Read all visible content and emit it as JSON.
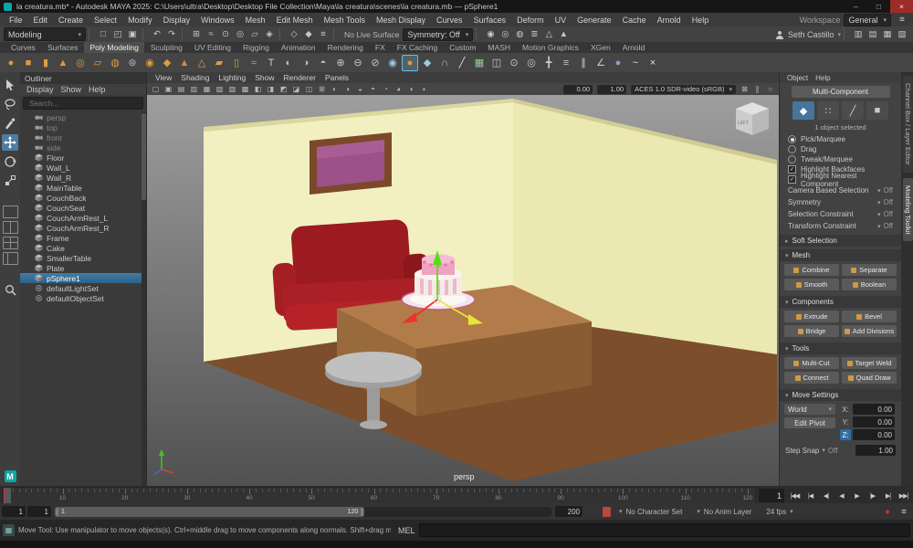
{
  "colors": {
    "accent": "#47749b",
    "selection": "#3f7ea8",
    "close_button": "#9d2c26",
    "maya_teal": "#0ba7a7",
    "manipulator_x": "#f03228",
    "manipulator_y": "#53e012",
    "manipulator_z": "#e8e43a"
  },
  "window": {
    "title": "la creatura.mb* - Autodesk MAYA 2025: C:\\Users\\ultra\\Desktop\\Desktop File Collection\\Maya\\la creatura\\scenes\\la creatura.mb — pSphere1",
    "controls": [
      {
        "name": "minimize-button",
        "glyph": "–"
      },
      {
        "name": "maximize-button",
        "glyph": "□"
      },
      {
        "name": "close-button",
        "glyph": "×",
        "close": true
      }
    ]
  },
  "menubar": {
    "items": [
      "File",
      "Edit",
      "Create",
      "Select",
      "Modify",
      "Display",
      "Windows",
      "Mesh",
      "Edit Mesh",
      "Mesh Tools",
      "Mesh Display",
      "Curves",
      "Surfaces",
      "Deform",
      "UV",
      "Generate",
      "Cache",
      "Arnold",
      "Help"
    ],
    "workspace_label": "Workspace",
    "workspace_value": "General"
  },
  "statusline": {
    "mode": "Modeling",
    "groups": [
      [
        {
          "name": "new-scene-icon",
          "glyph": "□"
        },
        {
          "name": "open-scene-icon",
          "glyph": "◰"
        },
        {
          "name": "save-scene-icon",
          "glyph": "▣"
        }
      ],
      [
        {
          "name": "undo-icon",
          "glyph": "↶"
        },
        {
          "name": "redo-icon",
          "glyph": "↷"
        }
      ],
      [
        {
          "name": "snap-to-grid-icon",
          "glyph": "⊞"
        },
        {
          "name": "snap-to-curve-icon",
          "glyph": "≈"
        },
        {
          "name": "snap-to-point-icon",
          "glyph": "⊙"
        },
        {
          "name": "snap-to-projected-center-icon",
          "glyph": "◎"
        },
        {
          "name": "snap-to-view-plane-icon",
          "glyph": "▱"
        },
        {
          "name": "make-live-icon",
          "glyph": "◈"
        }
      ],
      [
        {
          "name": "input-connections-icon",
          "glyph": "◇"
        },
        {
          "name": "output-connections-icon",
          "glyph": "◆"
        },
        {
          "name": "construction-history-icon",
          "glyph": "≡"
        }
      ]
    ],
    "live_surface": "No Live Surface",
    "symmetry": "Symmetry: Off",
    "render_group": [
      {
        "name": "open-render-view-icon",
        "glyph": "◉"
      },
      {
        "name": "render-current-frame-icon",
        "glyph": "◎"
      },
      {
        "name": "ipr-render-icon",
        "glyph": "◍"
      },
      {
        "name": "render-settings-icon",
        "glyph": "≣"
      },
      {
        "name": "toggle-displacement-icon",
        "glyph": "△"
      },
      {
        "name": "launch-arnold-icon",
        "glyph": "▲"
      }
    ],
    "user": "Seth Castillo",
    "right_icons": [
      {
        "name": "toggle-modeling-toolkit-icon",
        "glyph": "▥"
      },
      {
        "name": "toggle-attribute-editor-icon",
        "glyph": "▤"
      },
      {
        "name": "toggle-tool-settings-icon",
        "glyph": "▦"
      },
      {
        "name": "toggle-channel-box-icon",
        "glyph": "▧"
      }
    ]
  },
  "shelf": {
    "tabs": [
      "Curves",
      "Surfaces",
      "Poly Modeling",
      "Sculpting",
      "UV Editing",
      "Rigging",
      "Animation",
      "Rendering",
      "FX",
      "FX Caching",
      "Custom",
      "MASH",
      "Motion Graphics",
      "XGen",
      "Arnold"
    ],
    "active_tab": "Poly Modeling",
    "icons": [
      {
        "name": "poly-sphere-icon",
        "glyph": "●",
        "color": "#df9b41"
      },
      {
        "name": "poly-cube-icon",
        "glyph": "■",
        "color": "#df9b41"
      },
      {
        "name": "poly-cylinder-icon",
        "glyph": "▮",
        "color": "#df9b41"
      },
      {
        "name": "poly-cone-icon",
        "glyph": "▲",
        "color": "#df9b41"
      },
      {
        "name": "poly-torus-icon",
        "glyph": "◎",
        "color": "#df9b41"
      },
      {
        "name": "poly-plane-icon",
        "glyph": "▱",
        "color": "#df9b41"
      },
      {
        "name": "poly-disc-icon",
        "glyph": "◍",
        "color": "#df9b41"
      },
      {
        "name": "poly-gear-icon",
        "glyph": "⊛",
        "color": "#9fb6cc"
      },
      {
        "name": "poly-soccer-ball-icon",
        "glyph": "◉",
        "color": "#df9b41"
      },
      {
        "name": "poly-superellipse-icon",
        "glyph": "◆",
        "color": "#df9b41"
      },
      {
        "name": "poly-platonic-solid-icon",
        "glyph": "▲",
        "color": "#d98b3c"
      },
      {
        "name": "poly-pyramid-icon",
        "glyph": "△",
        "color": "#df9b41"
      },
      {
        "name": "poly-prism-icon",
        "glyph": "▰",
        "color": "#df9b41"
      },
      {
        "name": "poly-pipe-icon",
        "glyph": "▯",
        "color": "#df9b41"
      },
      {
        "name": "poly-helix-icon",
        "glyph": "≈",
        "color": "#df9b41"
      },
      {
        "name": "poly-type-icon",
        "glyph": "T",
        "color": "#cfcfcf"
      },
      {
        "name": "boolean-union-icon",
        "glyph": "◐",
        "color": "#a9c2d4"
      },
      {
        "name": "boolean-difference-icon",
        "glyph": "◑",
        "color": "#a9c2d4"
      },
      {
        "name": "boolean-intersection-icon",
        "glyph": "◓",
        "color": "#a9c2d4"
      },
      {
        "name": "combine-icon",
        "glyph": "⊕",
        "color": "#c9c9c9"
      },
      {
        "name": "separate-icon",
        "glyph": "⊖",
        "color": "#c9c9c9"
      },
      {
        "name": "extract-icon",
        "glyph": "⊘",
        "color": "#c9c9c9"
      },
      {
        "name": "smooth-icon",
        "glyph": "◉",
        "color": "#9cc8e4"
      },
      {
        "name": "poly-sphere-active-icon",
        "glyph": "●",
        "color": "#df9b41",
        "selected": true
      },
      {
        "name": "bevel-icon",
        "glyph": "◆",
        "color": "#9cc8e4"
      },
      {
        "name": "bridge-icon",
        "glyph": "∩",
        "color": "#9cc8e4"
      },
      {
        "name": "multi-cut-icon",
        "glyph": "╱",
        "color": "#e0e0e0"
      },
      {
        "name": "quad-draw-icon",
        "glyph": "▦",
        "color": "#93cd8f"
      },
      {
        "name": "mirror-icon",
        "glyph": "◫",
        "color": "#c9c9c9"
      },
      {
        "name": "merge-to-center-icon",
        "glyph": "⊙",
        "color": "#c9c9c9"
      },
      {
        "name": "target-weld-icon",
        "glyph": "◎",
        "color": "#c9c9c9"
      },
      {
        "name": "connect-icon",
        "glyph": "╋",
        "color": "#c9c9c9"
      },
      {
        "name": "insert-edge-loop-icon",
        "glyph": "≡",
        "color": "#c9c9c9"
      },
      {
        "name": "offset-edge-loop-icon",
        "glyph": "∥",
        "color": "#c9c9c9"
      },
      {
        "name": "crease-tool-icon",
        "glyph": "∠",
        "color": "#c9c9c9"
      },
      {
        "name": "sculpt-tool-icon",
        "glyph": "●",
        "color": "#b48ad4"
      },
      {
        "name": "curve-pencil-icon",
        "glyph": "~",
        "color": "#e0e0e0"
      },
      {
        "name": "knife-icon",
        "glyph": "×",
        "color": "#e0e0e0"
      }
    ]
  },
  "outliner": {
    "title": "Outliner",
    "menus": [
      "Display",
      "Show",
      "Help"
    ],
    "search_placeholder": "Search...",
    "items": [
      {
        "label": "persp",
        "type": "camera",
        "dim": true
      },
      {
        "label": "top",
        "type": "camera",
        "dim": true
      },
      {
        "label": "front",
        "type": "camera",
        "dim": true
      },
      {
        "label": "side",
        "type": "camera",
        "dim": true
      },
      {
        "label": "Floor",
        "type": "mesh"
      },
      {
        "label": "Wall_L",
        "type": "mesh"
      },
      {
        "label": "Wall_R",
        "type": "mesh"
      },
      {
        "label": "MainTable",
        "type": "mesh"
      },
      {
        "label": "CouchBack",
        "type": "mesh"
      },
      {
        "label": "CouchSeat",
        "type": "mesh"
      },
      {
        "label": "CouchArmRest_L",
        "type": "mesh"
      },
      {
        "label": "CouchArmRest_R",
        "type": "mesh"
      },
      {
        "label": "Frame",
        "type": "mesh"
      },
      {
        "label": "Cake",
        "type": "mesh"
      },
      {
        "label": "SmallerTable",
        "type": "mesh"
      },
      {
        "label": "Plate",
        "type": "mesh"
      },
      {
        "label": "pSphere1",
        "type": "mesh",
        "selected": true
      },
      {
        "label": "defaultLightSet",
        "type": "set"
      },
      {
        "label": "defaultObjectSet",
        "type": "set"
      }
    ]
  },
  "viewport": {
    "menus": [
      "View",
      "Shading",
      "Lighting",
      "Show",
      "Renderer",
      "Panels"
    ],
    "icons_a": [
      {
        "name": "lock-camera-icon",
        "glyph": "▢"
      },
      {
        "name": "camera-attributes-icon",
        "glyph": "▣"
      },
      {
        "name": "bookmarks-icon",
        "glyph": "▤"
      },
      {
        "name": "image-plane-icon",
        "glyph": "▥"
      },
      {
        "name": "2d-pan-zoom-icon",
        "glyph": "▦"
      },
      {
        "name": "overscan-icon",
        "glyph": "▧"
      },
      {
        "name": "film-gate-icon",
        "glyph": "▨"
      },
      {
        "name": "resolution-gate-icon",
        "glyph": "▩"
      },
      {
        "name": "gate-mask-icon",
        "glyph": "◧"
      },
      {
        "name": "field-chart-icon",
        "glyph": "◨"
      },
      {
        "name": "safe-action-icon",
        "glyph": "◩"
      },
      {
        "name": "safe-title-icon",
        "glyph": "◪"
      },
      {
        "name": "frame-all-icon",
        "glyph": "◫"
      },
      {
        "name": "frame-selection-icon",
        "glyph": "⊞"
      },
      {
        "name": "lighting-icon",
        "glyph": "◐"
      },
      {
        "name": "shadows-icon",
        "glyph": "◑"
      },
      {
        "name": "screen-space-ao-icon",
        "glyph": "◒"
      },
      {
        "name": "motion-blur-icon",
        "glyph": "◓"
      },
      {
        "name": "multisample-aa-icon",
        "glyph": "◔"
      },
      {
        "name": "depth-of-field-icon",
        "glyph": "◕"
      },
      {
        "name": "isolate-select-icon",
        "glyph": "◖"
      },
      {
        "name": "xray-icon",
        "glyph": "◗"
      }
    ],
    "exposure": "0.00",
    "gamma": "1.00",
    "colorspace": "ACES 1.0 SDR-video (sRGB)",
    "icons_b": [
      {
        "name": "snapshot-icon",
        "glyph": "⊠"
      },
      {
        "name": "pause-viewport-icon",
        "glyph": "∥"
      },
      {
        "name": "refresh-viewport-icon",
        "glyph": "○"
      }
    ],
    "camera_label": "persp"
  },
  "toolkit": {
    "menus": [
      "Object",
      "Help"
    ],
    "multi_component": "Multi-Component",
    "modes": [
      {
        "name": "multi-component-mode-icon",
        "glyph": "◆",
        "active": true
      },
      {
        "name": "vertex-mode-icon",
        "glyph": "∷"
      },
      {
        "name": "edge-mode-icon",
        "glyph": "╱"
      },
      {
        "name": "face-mode-icon",
        "glyph": "■"
      }
    ],
    "selected_info": "1 object selected",
    "radios": [
      {
        "label": "Pick/Marquee",
        "selected": true
      },
      {
        "label": "Drag"
      },
      {
        "label": "Tweak/Marquee"
      }
    ],
    "checkboxes": [
      {
        "label": "Highlight Backfaces",
        "checked": true
      },
      {
        "label": "Highlight Nearest Component",
        "checked": true
      }
    ],
    "constraints": [
      {
        "label": "Camera Based Selection",
        "value": "Off"
      },
      {
        "label": "Symmetry",
        "value": "Off"
      },
      {
        "label": "Selection Constraint",
        "value": "Off"
      },
      {
        "label": "Transform Constraint",
        "value": "Off"
      }
    ],
    "soft_selection": "Soft Selection",
    "sections": [
      {
        "title": "Mesh",
        "buttons": [
          "Combine",
          "Separate",
          "Smooth",
          "Boolean"
        ]
      },
      {
        "title": "Components",
        "buttons": [
          "Extrude",
          "Bevel",
          "Bridge",
          "Add Divisions"
        ]
      },
      {
        "title": "Tools",
        "buttons": [
          "Multi-Cut",
          "Target Weld",
          "Connect",
          "Quad Draw"
        ]
      }
    ],
    "move_settings": {
      "title": "Move Settings",
      "axis_orientation": "World",
      "edit_pivot": "Edit Pivot",
      "fields": [
        {
          "axis": "X",
          "value": "0.00"
        },
        {
          "axis": "Y",
          "value": "0.00"
        },
        {
          "axis": "Z",
          "value": "0.00",
          "highlight": true
        }
      ],
      "step_snap_label": "Step Snap",
      "step_snap_value": "Off",
      "step_size": "1.00"
    }
  },
  "side_tabs": [
    {
      "label": "Channel Box / Layer Editor"
    },
    {
      "label": "Modeling Toolkit",
      "active": true
    }
  ],
  "timeline": {
    "start": 1,
    "end": 120,
    "label_step": 10,
    "current": 1,
    "current_display": "1"
  },
  "playback": {
    "buttons": [
      {
        "name": "go-to-start-button",
        "glyph": "|◀◀"
      },
      {
        "name": "step-back-key-button",
        "glyph": "|◀"
      },
      {
        "name": "step-back-frame-button",
        "glyph": "◀|"
      },
      {
        "name": "play-backward-button",
        "glyph": "◀"
      },
      {
        "name": "play-forward-button",
        "glyph": "▶"
      },
      {
        "name": "step-forward-frame-button",
        "glyph": "|▶"
      },
      {
        "name": "step-forward-key-button",
        "glyph": "▶|"
      },
      {
        "name": "go-to-end-button",
        "glyph": "▶▶|"
      }
    ]
  },
  "range": {
    "anim_start": "1",
    "playback_start": "1",
    "playback_end": "120",
    "anim_end": "200",
    "char_set": "No Character Set",
    "anim_layer": "No Anim Layer",
    "fps": "24 fps"
  },
  "helpline": {
    "text": "Move Tool: Use manipulator to move objects(s). Ctrl+middle drag to move components along normals. Shift+drag manipulator axis or plane handles to extrude components in sh",
    "mel_label": "MEL"
  }
}
